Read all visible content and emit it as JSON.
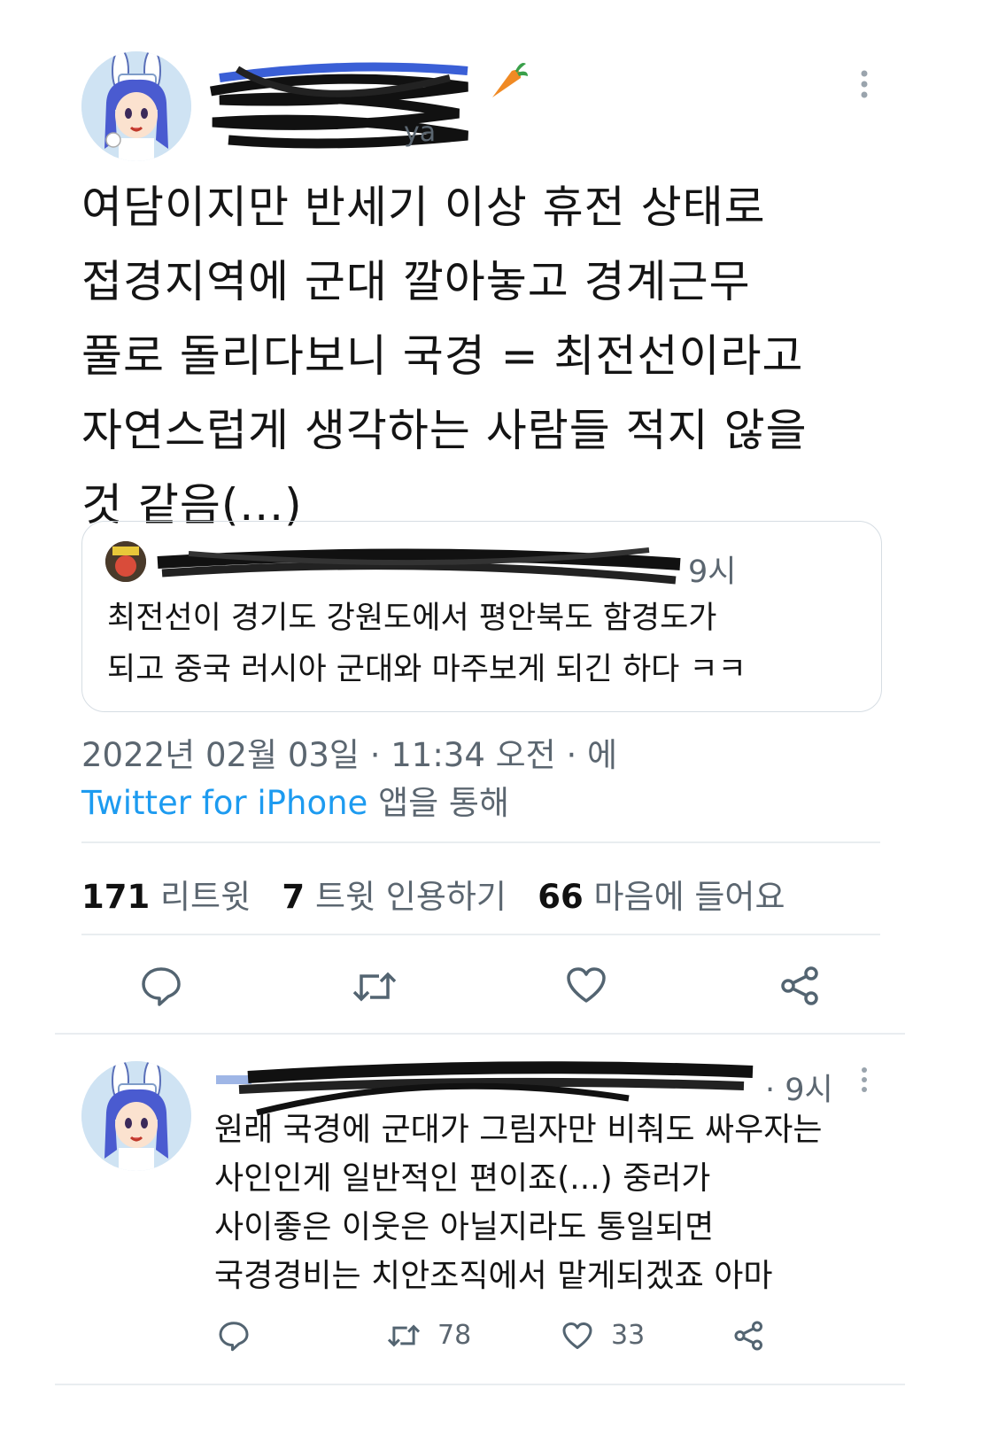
{
  "tweet": {
    "time_ago": "",
    "text_lines": [
      "여담이지만 반세기 이상 휴전 상태로",
      "접경지역에 군대 깔아놓고 경계근무",
      "풀로 돌리다보니 국경 = 최전선이라고",
      "자연스럽게 생각하는 사람들 적지 않을",
      "것 같음(...)"
    ],
    "quote": {
      "time": "9시",
      "text_lines": [
        "최전선이 경기도 강원도에서 평안북도 함경도가",
        "되고 중국 러시아 군대와 마주보게 되긴 하다 ㅋㅋ"
      ]
    },
    "timestamp": "2022년 02월 03일 · 11:34 오전 · 에",
    "source_app": "Twitter for iPhone",
    "source_suffix": " 앱을 통해",
    "stats": {
      "retweets_count": "171",
      "retweets_label": "리트윗",
      "quotes_count": "7",
      "quotes_label": "트윗 인용하기",
      "likes_count": "66",
      "likes_label": "마음에 들어요"
    },
    "actions": [
      "reply-icon",
      "retweet-icon",
      "like-icon",
      "share-icon"
    ]
  },
  "reply": {
    "time": "· 9시",
    "text_lines": [
      "원래 국경에 군대가 그림자만 비춰도 싸우자는",
      "사인인게 일반적인 편이죠(...) 중러가",
      "사이좋은 이웃은 아닐지라도 통일되면",
      "국경경비는 치안조직에서 맡게되겠죠 아마"
    ],
    "retweets": "78",
    "likes": "33"
  },
  "colors": {
    "accent": "#1d9bf0",
    "muted": "#5b6670",
    "divider": "#e9edf0",
    "carrot": "#f08a24"
  }
}
